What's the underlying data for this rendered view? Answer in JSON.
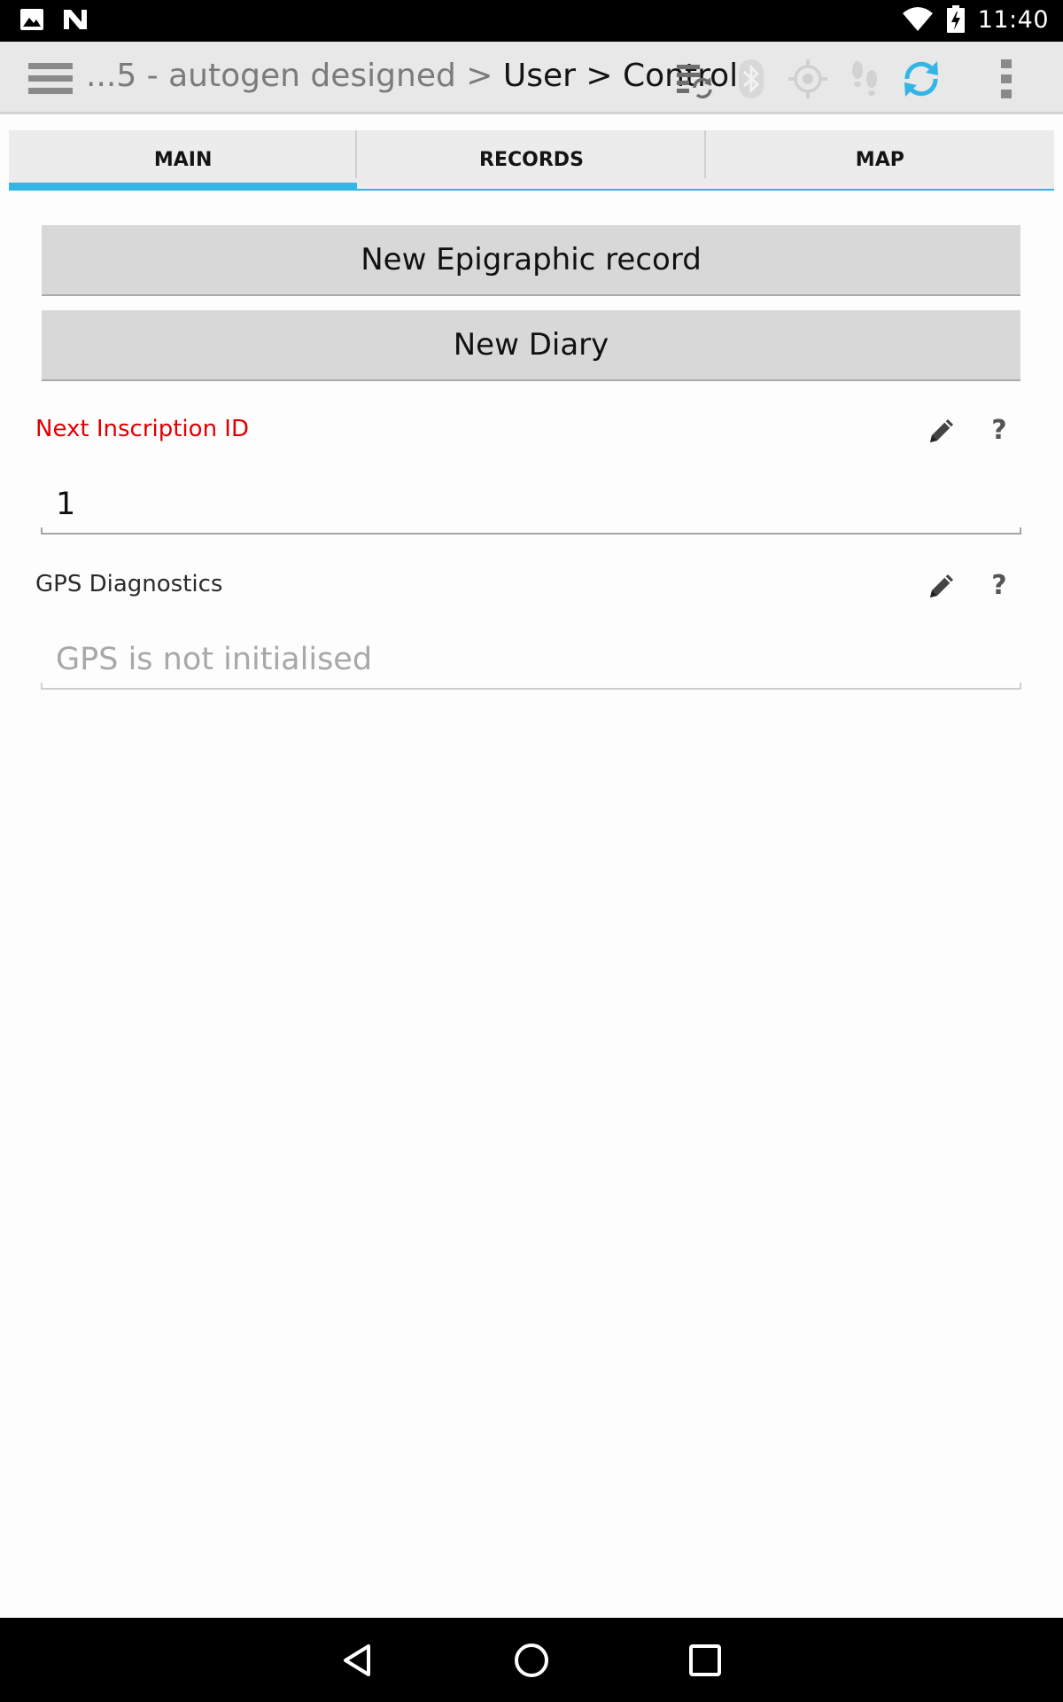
{
  "status_bar": {
    "time": "11:40",
    "left_icons": [
      "image-icon",
      "n-icon"
    ],
    "right_icons": [
      "wifi-icon",
      "battery-icon"
    ]
  },
  "action_bar": {
    "title_prefix": "...5 - autogen designed > ",
    "title_current": "User > Control",
    "icons": [
      "menu-icon",
      "sync-records-icon",
      "bluetooth-icon",
      "gps-icon",
      "tracking-footsteps-icon",
      "sync-icon",
      "overflow-menu-icon"
    ],
    "accent_color": "#33b5e5"
  },
  "tabs": [
    {
      "label": "MAIN",
      "active": true
    },
    {
      "label": "RECORDS",
      "active": false
    },
    {
      "label": "MAP",
      "active": false
    }
  ],
  "main": {
    "buttons": {
      "new_epigraphic_record": "New Epigraphic record",
      "new_diary": "New Diary"
    },
    "next_inscription": {
      "label": "Next Inscription ID",
      "value": "1",
      "label_color": "#e00000"
    },
    "gps_diagnostics": {
      "label": "GPS Diagnostics",
      "placeholder": "GPS is not initialised"
    },
    "help_glyph": "?"
  },
  "nav_bar": {
    "icons": [
      "back-icon",
      "home-icon",
      "recents-icon"
    ]
  }
}
